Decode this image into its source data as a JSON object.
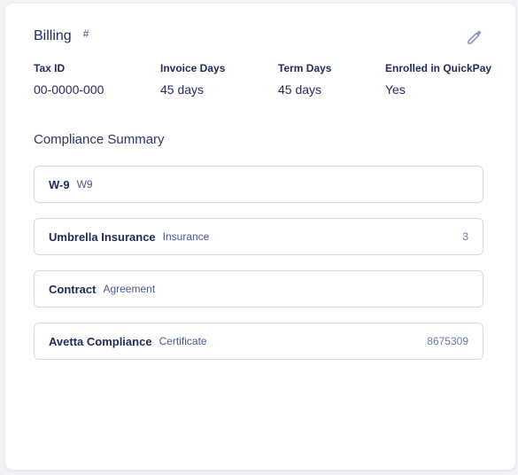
{
  "billing": {
    "title": "Billing",
    "hash": "#",
    "fields": [
      {
        "label": "Tax ID",
        "value": "00-0000-000"
      },
      {
        "label": "Invoice Days",
        "value": "45 days"
      },
      {
        "label": "Term Days",
        "value": "45 days"
      },
      {
        "label": "Enrolled in QuickPay",
        "value": "Yes"
      }
    ],
    "edit_icon": "pencil-icon"
  },
  "compliance": {
    "title": "Compliance Summary",
    "items": [
      {
        "name": "W-9",
        "type": "W9",
        "count": ""
      },
      {
        "name": "Umbrella Insurance",
        "type": "Insurance",
        "count": "3"
      },
      {
        "name": "Contract",
        "type": "Agreement",
        "count": ""
      },
      {
        "name": "Avetta Compliance",
        "type": "Certificate",
        "count": "8675309"
      }
    ]
  },
  "colors": {
    "text_primary": "#1f2a5a",
    "text_secondary": "#4a5695",
    "border": "#d4d8e6",
    "icon": "#8a93bf"
  }
}
